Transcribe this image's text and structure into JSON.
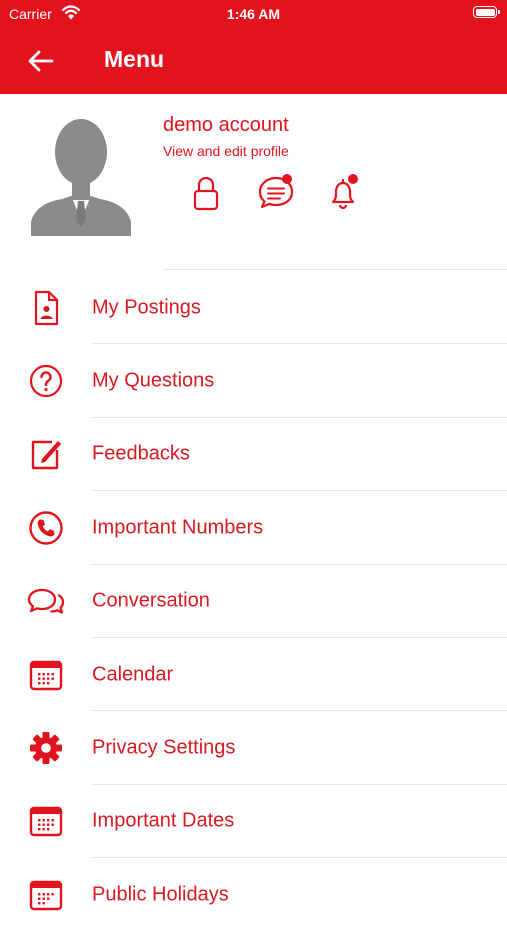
{
  "status_bar": {
    "carrier": "Carrier",
    "time": "1:46 AM"
  },
  "header": {
    "title": "Menu"
  },
  "profile": {
    "name": "demo account",
    "edit_link": "View and edit profile"
  },
  "menu": {
    "items": [
      {
        "label": "My Postings",
        "icon": "posting-document-icon"
      },
      {
        "label": "My Questions",
        "icon": "question-circle-icon"
      },
      {
        "label": "Feedbacks",
        "icon": "edit-square-icon"
      },
      {
        "label": "Important Numbers",
        "icon": "phone-circle-icon"
      },
      {
        "label": "Conversation",
        "icon": "chat-bubbles-icon"
      },
      {
        "label": "Calendar",
        "icon": "calendar-icon"
      },
      {
        "label": "Privacy Settings",
        "icon": "gear-icon"
      },
      {
        "label": "Important Dates",
        "icon": "calendar-dates-icon"
      },
      {
        "label": "Public Holidays",
        "icon": "holiday-calendar-icon"
      }
    ]
  },
  "colors": {
    "accent": "#e3131d",
    "text_red": "#d71a21",
    "divider": "#e6e6e6",
    "avatar_gray": "#8a8a8a"
  }
}
